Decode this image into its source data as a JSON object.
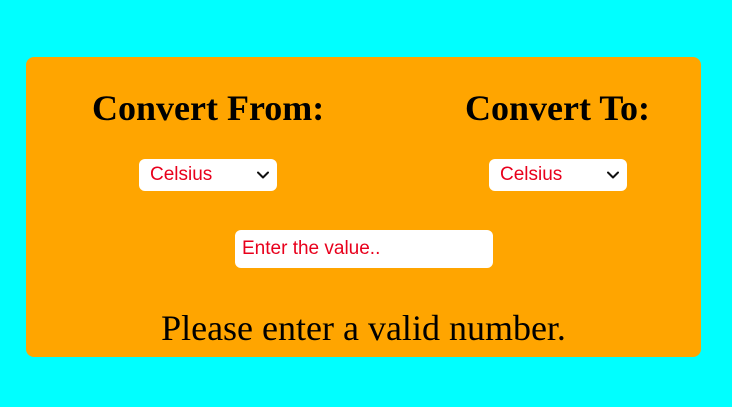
{
  "colors": {
    "page_background": "#00ffff",
    "card_background": "#ffa500",
    "control_text": "#e8001c",
    "heading_text": "#000000"
  },
  "from": {
    "heading": "Convert From:",
    "selected_unit": "Celsius",
    "icon": "chevron-down-icon"
  },
  "to": {
    "heading": "Convert To:",
    "selected_unit": "Celsius",
    "icon": "chevron-down-icon"
  },
  "value_input": {
    "value": "",
    "placeholder": "Enter the value.."
  },
  "result": {
    "message": "Please enter a valid number."
  }
}
